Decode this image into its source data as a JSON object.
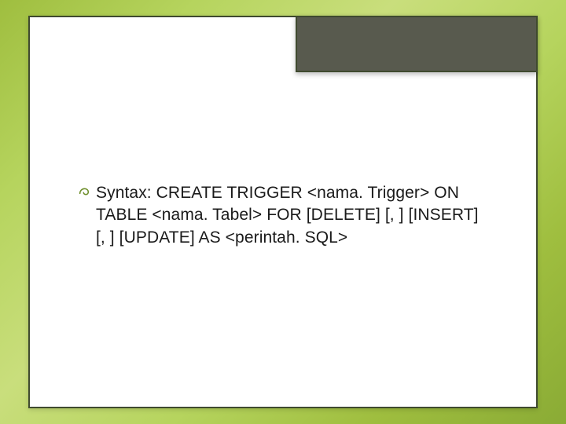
{
  "slide": {
    "title": "",
    "bullets": [
      {
        "label": "Syntax:",
        "rest": " CREATE TRIGGER <nama. Trigger> ON TABLE <nama. Tabel> FOR [DELETE] [, ] [INSERT] [, ] [UPDATE] AS <perintah. SQL>"
      }
    ]
  },
  "colors": {
    "accent": "#6f8f2d",
    "tab_bg": "#585a4e",
    "border": "#3f4a2f"
  }
}
